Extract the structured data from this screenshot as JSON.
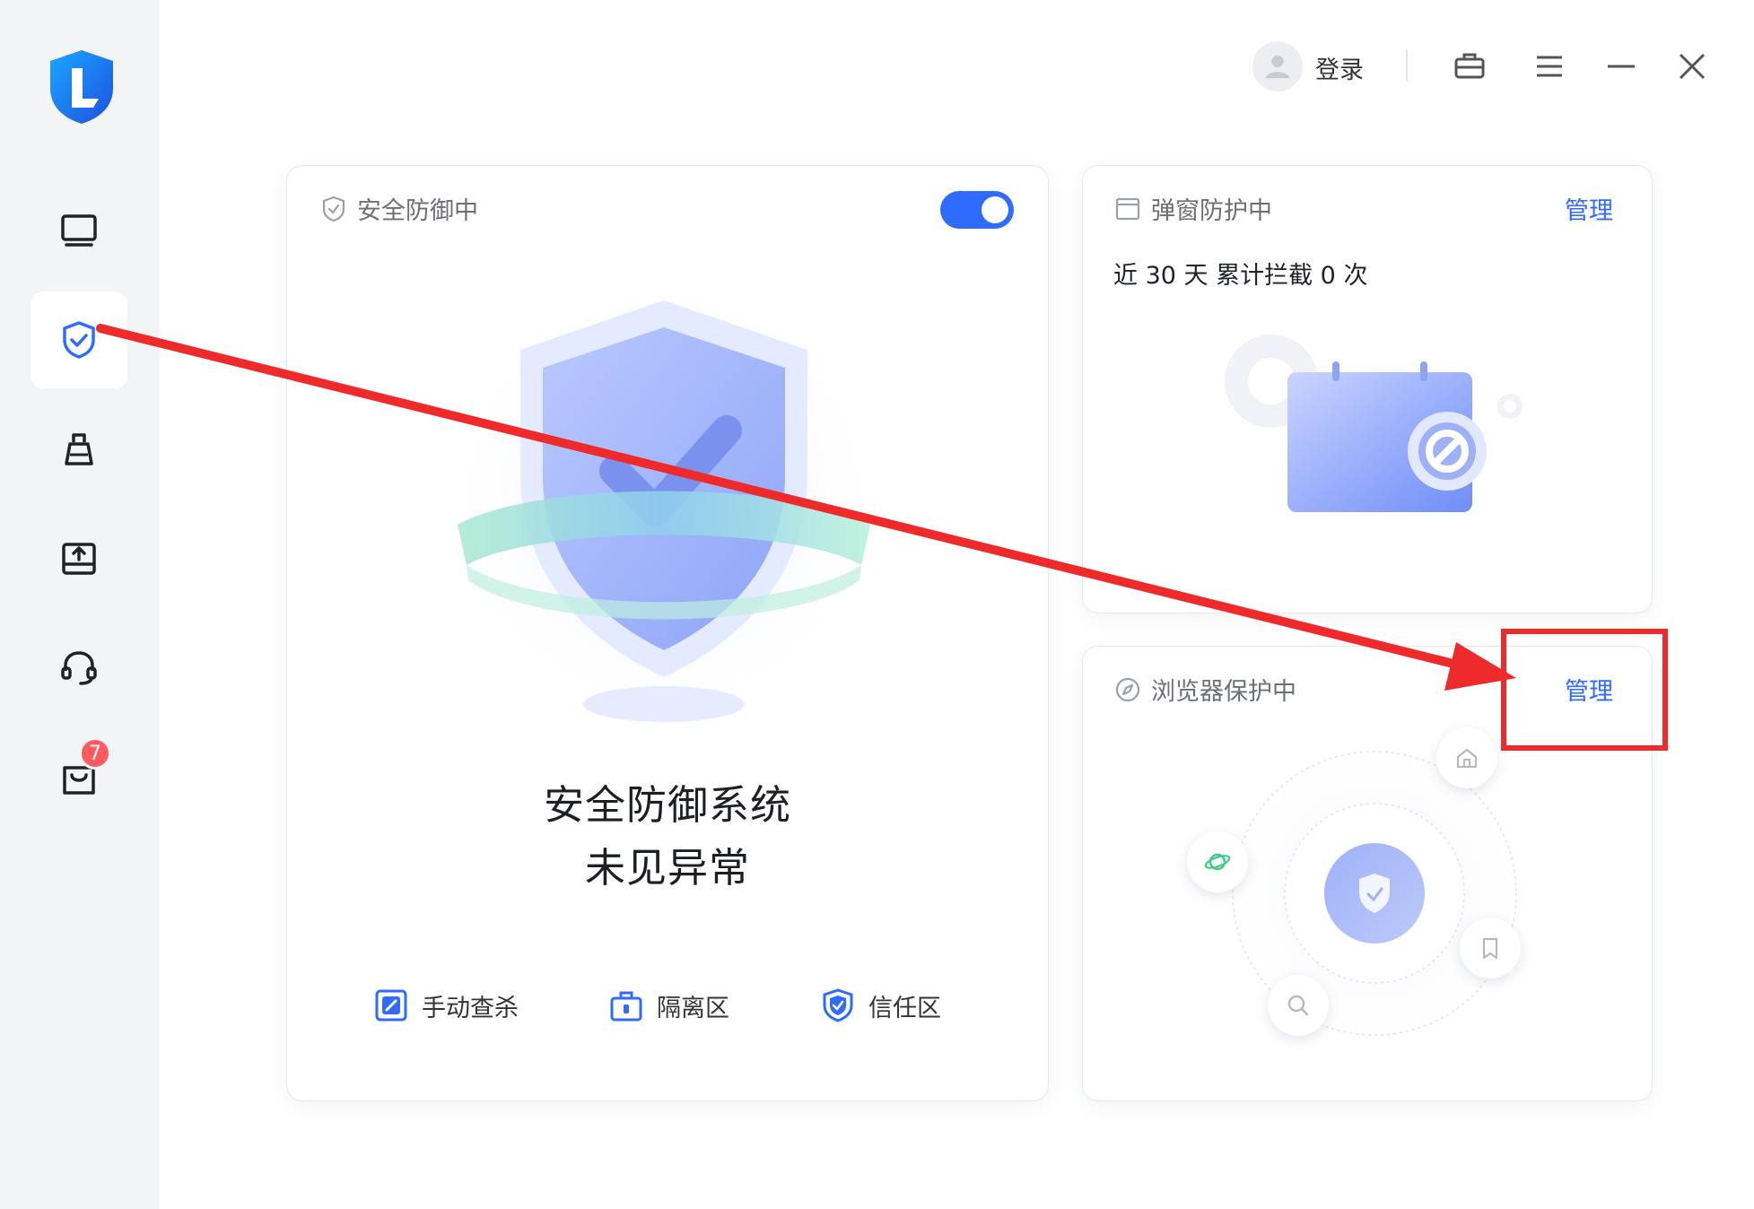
{
  "header": {
    "login_label": "登录",
    "icons": [
      "user-avatar-icon",
      "toolbox-icon",
      "menu-icon",
      "minimize-icon",
      "close-icon"
    ]
  },
  "sidebar": {
    "logo": "shield-logo",
    "items": [
      {
        "name": "computer",
        "icon": "monitor-icon"
      },
      {
        "name": "security",
        "icon": "shield-check-icon",
        "active": true
      },
      {
        "name": "cleanup",
        "icon": "broom-icon"
      },
      {
        "name": "software",
        "icon": "software-upload-icon"
      },
      {
        "name": "support",
        "icon": "headset-icon"
      },
      {
        "name": "store",
        "icon": "bag-icon",
        "badge": "7"
      }
    ]
  },
  "main_card": {
    "title": "安全防御中",
    "toggle_on": true,
    "status_line1": "安全防御系统",
    "status_line2": "未见异常",
    "actions": [
      {
        "label": "手动查杀",
        "icon": "scan-icon"
      },
      {
        "label": "隔离区",
        "icon": "quarantine-icon"
      },
      {
        "label": "信任区",
        "icon": "trust-shield-icon"
      }
    ]
  },
  "popup_card": {
    "title": "弹窗防护中",
    "manage_label": "管理",
    "stat": "近 30 天 累计拦截 0 次"
  },
  "browser_card": {
    "title": "浏览器保护中",
    "manage_label": "管理"
  },
  "colors": {
    "accent": "#2f6bff",
    "sidebar_bg": "#f3f4f6",
    "annotation_red": "#ee2a2a",
    "badge": "#ff5a5f"
  }
}
